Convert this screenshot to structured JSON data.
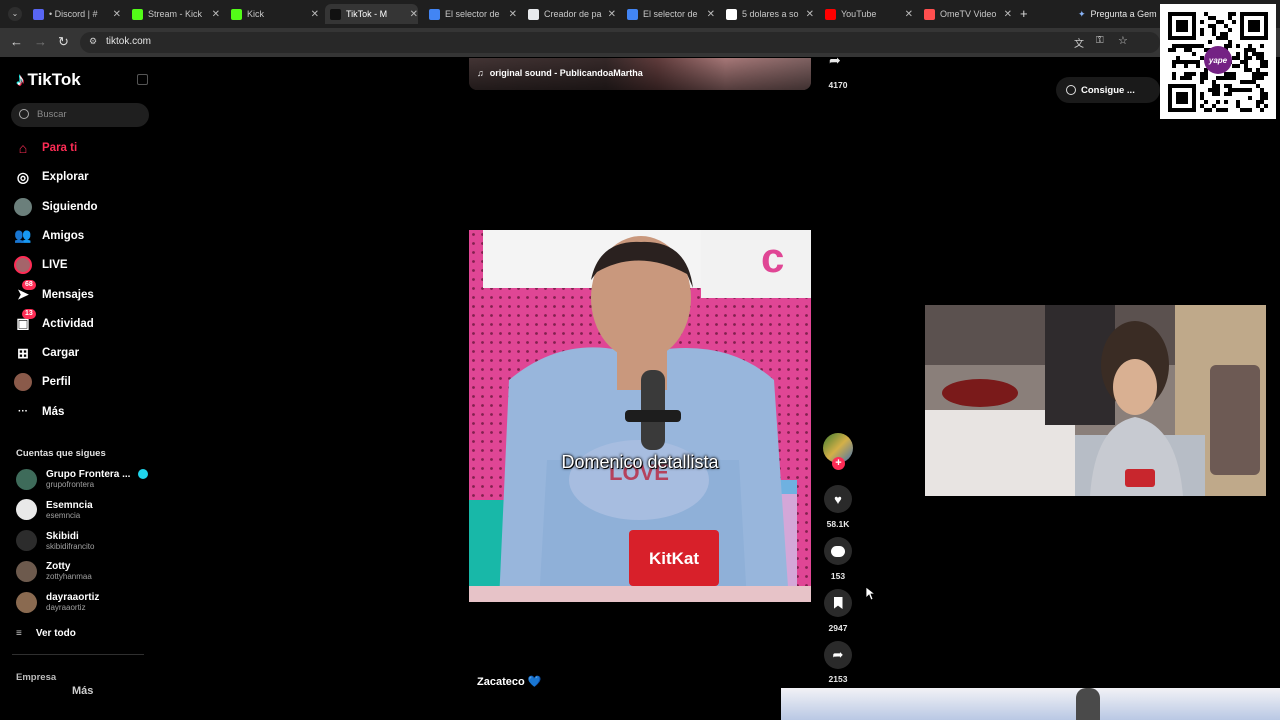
{
  "browser": {
    "tabs": [
      {
        "label": "• Discord | #",
        "color": "#5865f2",
        "active": false
      },
      {
        "label": "Stream - Kick",
        "color": "#53fc18",
        "active": false
      },
      {
        "label": "Kick",
        "color": "#53fc18",
        "active": false
      },
      {
        "label": "TikTok - M",
        "color": "#111111",
        "active": true
      },
      {
        "label": "El selector de",
        "color": "#4285f4",
        "active": false
      },
      {
        "label": "Creador de pa",
        "color": "#e8eaed",
        "active": false
      },
      {
        "label": "El selector de",
        "color": "#4285f4",
        "active": false
      },
      {
        "label": "5 dolares a so",
        "color": "#ffffff",
        "active": false
      },
      {
        "label": "YouTube",
        "color": "#ff0000",
        "active": false
      },
      {
        "label": "OmeTV Video",
        "color": "#ff4f4f",
        "active": false
      }
    ],
    "gemini_label": "Pregunta a Gem",
    "url": "tiktok.com"
  },
  "tiktok": {
    "logo": "TikTok",
    "search_placeholder": "Buscar",
    "nav": [
      {
        "label": "Para ti",
        "icon": "home-icon",
        "badge": "",
        "active": true
      },
      {
        "label": "Explorar",
        "icon": "compass-icon",
        "badge": "",
        "active": false
      },
      {
        "label": "Siguiendo",
        "icon": "following-avatar-icon",
        "badge": "",
        "active": false
      },
      {
        "label": "Amigos",
        "icon": "friends-icon",
        "badge": "",
        "active": false
      },
      {
        "label": "LIVE",
        "icon": "live-avatar-icon",
        "badge": "",
        "active": false
      },
      {
        "label": "Mensajes",
        "icon": "paper-plane-icon",
        "badge": "68",
        "active": false
      },
      {
        "label": "Actividad",
        "icon": "activity-icon",
        "badge": "13",
        "active": false
      },
      {
        "label": "Cargar",
        "icon": "upload-icon",
        "badge": "",
        "active": false
      },
      {
        "label": "Perfil",
        "icon": "profile-avatar-icon",
        "badge": "",
        "active": false
      },
      {
        "label": "Más",
        "icon": "more-dots-icon",
        "badge": "",
        "active": false
      }
    ],
    "following_title": "Cuentas que sigues",
    "following": [
      {
        "name": "Grupo Frontera ...",
        "handle": "grupofrontera",
        "verified": true
      },
      {
        "name": "Esemncia",
        "handle": "esemncia",
        "verified": false
      },
      {
        "name": "Skibidi",
        "handle": "skibidifrancito",
        "verified": false
      },
      {
        "name": "Zotty",
        "handle": "zottyhanmaa",
        "verified": false
      },
      {
        "name": "dayraaortiz",
        "handle": "dayraaortiz",
        "verified": false
      }
    ],
    "see_all": "Ver todo",
    "footer_label": "Empresa",
    "footer_more": "Más",
    "get_coins": "Consigue ...",
    "prev_video": {
      "sound": "original sound - PublicandoaMartha",
      "share_count": "4170"
    },
    "current_video": {
      "subtitle": "Domenico detallista",
      "likes": "58.1K",
      "comments": "153",
      "saves": "2947",
      "shares": "2153"
    },
    "next_video": {
      "caption": "Zacateco 💙"
    }
  },
  "overlay": {
    "qr_brand": "yape"
  }
}
